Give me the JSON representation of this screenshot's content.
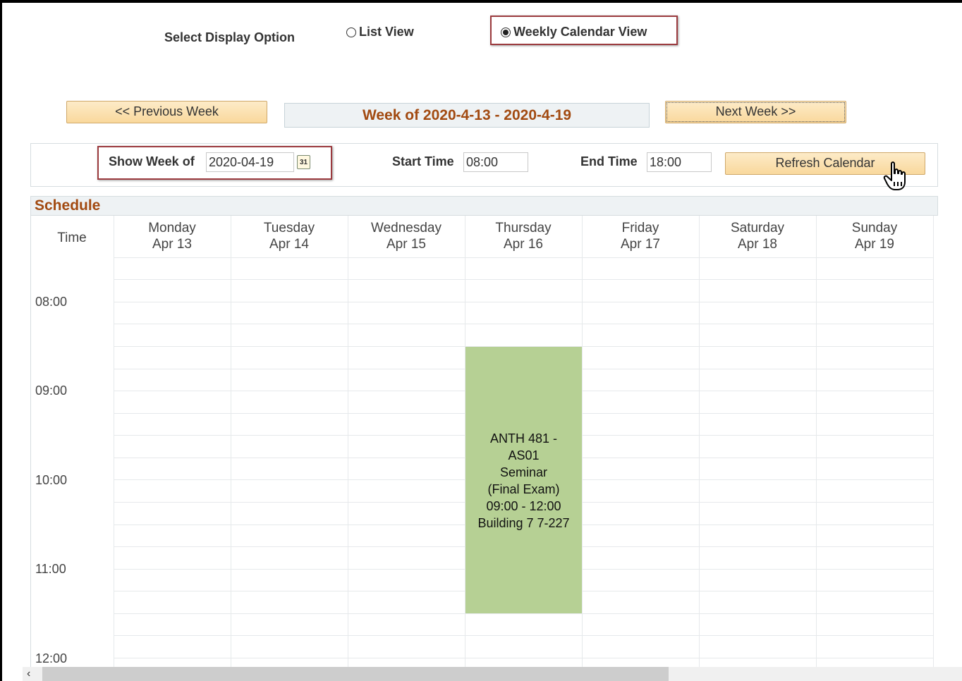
{
  "display_option": {
    "label": "Select Display Option",
    "options": [
      {
        "label": "List View",
        "selected": false
      },
      {
        "label": "Weekly Calendar View",
        "selected": true
      }
    ]
  },
  "nav": {
    "prev_label": "<< Previous Week",
    "week_label": "Week of 2020-4-13 - 2020-4-19",
    "next_label": "Next Week >>"
  },
  "filters": {
    "show_week_label": "Show Week of",
    "show_week_value": "2020-04-19",
    "calendar_icon_text": "31",
    "start_time_label": "Start Time",
    "start_time_value": "08:00",
    "end_time_label": "End Time",
    "end_time_value": "18:00",
    "refresh_label": "Refresh Calendar"
  },
  "schedule": {
    "title": "Schedule",
    "time_header": "Time",
    "days": [
      {
        "day": "Monday",
        "date": "Apr 13"
      },
      {
        "day": "Tuesday",
        "date": "Apr 14"
      },
      {
        "day": "Wednesday",
        "date": "Apr 15"
      },
      {
        "day": "Thursday",
        "date": "Apr 16"
      },
      {
        "day": "Friday",
        "date": "Apr 17"
      },
      {
        "day": "Saturday",
        "date": "Apr 18"
      },
      {
        "day": "Sunday",
        "date": "Apr 19"
      }
    ],
    "times": [
      "08:00",
      "09:00",
      "10:00",
      "11:00",
      "12:00"
    ],
    "event": {
      "lines": [
        "ANTH 481 -",
        "AS01",
        "Seminar",
        "(Final Exam)",
        "09:00 - 12:00",
        "Building 7 7-227"
      ],
      "color": "#b6d094"
    }
  },
  "colors": {
    "accent": "#a24a11",
    "highlight_border": "#9b3a3e",
    "button": "#f9d89c"
  },
  "icons": [
    "calendar-icon",
    "hand-pointer-icon",
    "scroll-left-icon"
  ]
}
